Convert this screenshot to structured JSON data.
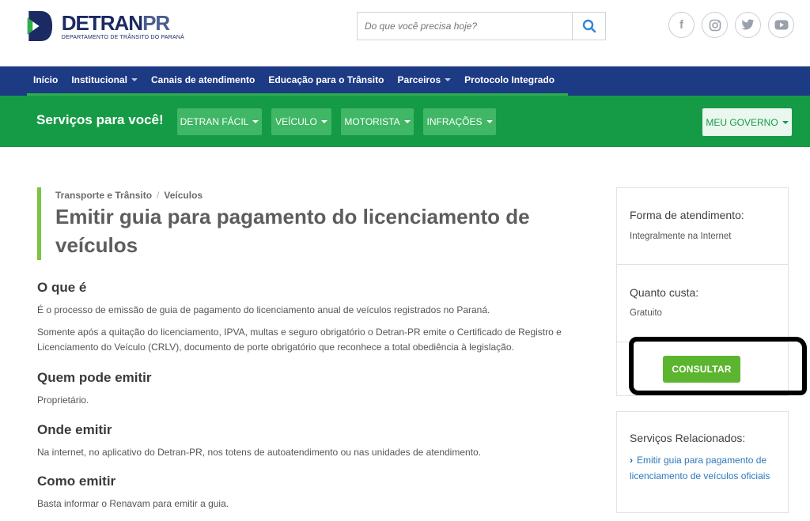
{
  "header": {
    "logo_name": "DETRAN",
    "logo_suffix": "PR",
    "logo_subtitle": "DEPARTAMENTO DE TRÂNSITO DO PARANÁ",
    "search_placeholder": "Do que você precisa hoje?",
    "socials": [
      {
        "icon": "facebook-icon",
        "glyph": "f"
      },
      {
        "icon": "instagram-icon",
        "glyph": "◎"
      },
      {
        "icon": "twitter-icon",
        "glyph": "🐦"
      },
      {
        "icon": "youtube-icon",
        "glyph": "▶"
      }
    ]
  },
  "nav": {
    "items": [
      "Início",
      "Institucional",
      "Canais de atendimento",
      "Educação para o Trânsito",
      "Parceiros",
      "Protocolo Integrado"
    ]
  },
  "services": {
    "title": "Serviços para você!",
    "buttons": [
      "DETRAN FÁCIL",
      "VEÍCULO",
      "MOTORISTA",
      "INFRAÇÕES"
    ],
    "gov_button": "MEU GOVERNO"
  },
  "content": {
    "breadcrumb": [
      "Transporte e Trânsito",
      "Veículos"
    ],
    "title_line1": "Emitir guia para pagamento do licenciamento de",
    "title_line2": "veículos",
    "sections": [
      {
        "heading": "O que é",
        "paragraphs": [
          "É o processo de emissão de guia de pagamento do licenciamento anual de veículos registrados no Paraná.",
          "Somente após a quitação do licenciamento, IPVA, multas e seguro obrigatório o Detran-PR emite o Certificado de Registro e Licenciamento do Veículo (CRLV), documento de porte obrigatório que reconhece a total obediência à legislação."
        ]
      },
      {
        "heading": "Quem pode emitir",
        "paragraphs": [
          "Proprietário."
        ]
      },
      {
        "heading": "Onde emitir",
        "paragraphs": [
          "Na internet, no aplicativo do Detran-PR, nos totens de autoatendimento ou nas unidades de atendimento."
        ]
      },
      {
        "heading": "Como emitir",
        "paragraphs": [
          "Basta informar o Renavam para emitir a guia."
        ]
      }
    ]
  },
  "sidebar": {
    "forma_label": "Forma de atendimento:",
    "forma_value": "Integralmente na Internet",
    "custo_label": "Quanto custa:",
    "custo_value": "Gratuito",
    "consultar_button": "CONSULTAR",
    "related_label": "Serviços Relacionados:",
    "related_link": "Emitir guia para pagamento de licenciamento de veículos oficiais"
  },
  "colors": {
    "nav_blue": "#1d3a84",
    "services_green": "#159b46",
    "accent_green": "#5cb52f",
    "link_blue": "#2e77bb"
  }
}
